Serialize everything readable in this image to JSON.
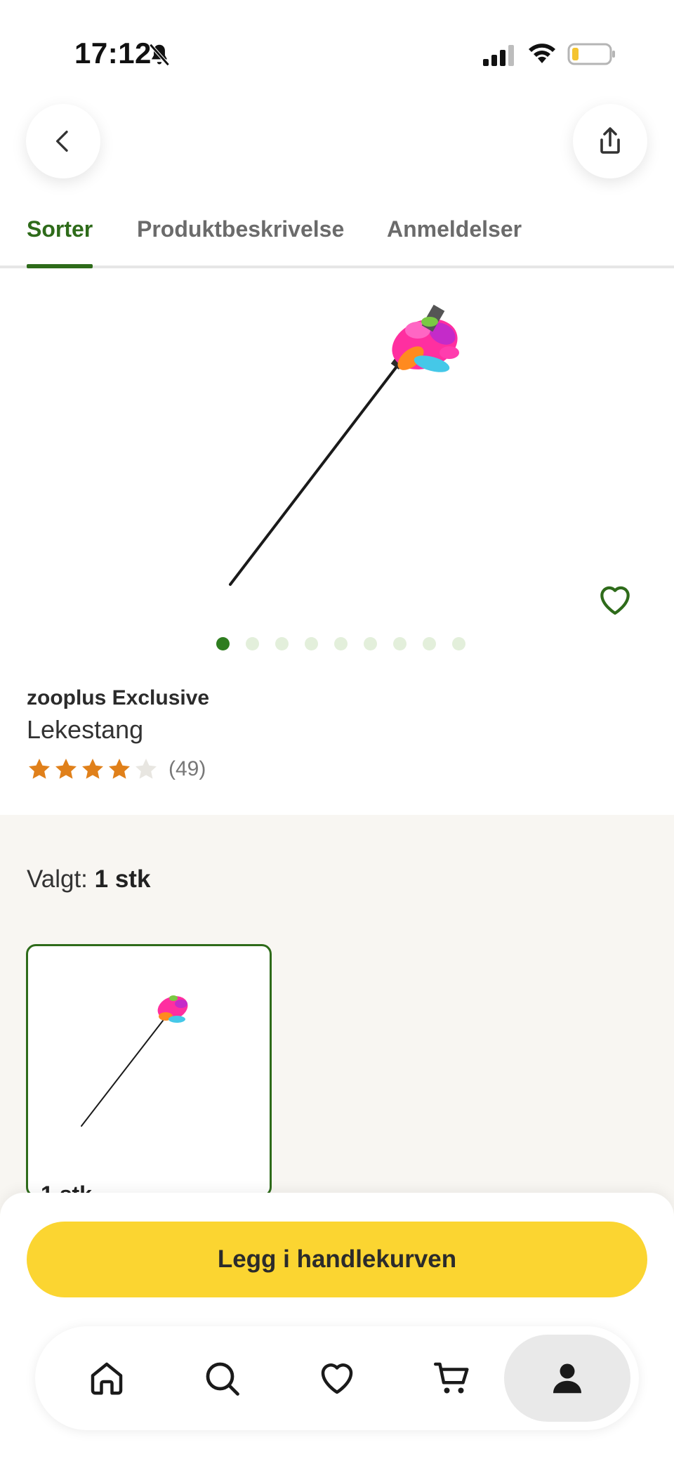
{
  "status_bar": {
    "time": "17:12",
    "icons": [
      "bell-slash-icon",
      "cellular-signal-icon",
      "wifi-icon",
      "battery-low-icon"
    ]
  },
  "nav": {
    "back_icon": "chevron-left-icon",
    "share_icon": "share-icon"
  },
  "tabs": [
    {
      "label": "Sorter",
      "active": true
    },
    {
      "label": "Produktbeskrivelse",
      "active": false
    },
    {
      "label": "Anmeldelser",
      "active": false
    }
  ],
  "gallery": {
    "image_count": 9,
    "active_index": 0
  },
  "product": {
    "brand": "zooplus Exclusive",
    "name": "Lekestang",
    "rating": 4,
    "rating_max": 5,
    "review_count": "(49)"
  },
  "variant": {
    "selected_prefix": "Valgt: ",
    "selected_value": "1 stk",
    "options": [
      {
        "label": "1 stk",
        "selected": true
      }
    ]
  },
  "cta": {
    "add_to_cart": "Legg i handlekurven"
  },
  "tabbar": {
    "items": [
      "home-icon",
      "search-icon",
      "heart-icon",
      "cart-icon",
      "profile-icon"
    ],
    "active": "profile-icon"
  },
  "colors": {
    "accent_green": "#2e6b1a",
    "cta_yellow": "#fbd531",
    "star_orange": "#e0801a",
    "section_bg": "#f8f6f2"
  }
}
